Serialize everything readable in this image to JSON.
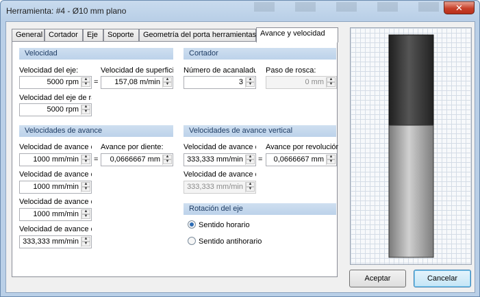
{
  "window": {
    "title": "Herramienta: #4 - Ø10 mm plano",
    "close_glyph": "✕"
  },
  "tabs": [
    {
      "label": "General"
    },
    {
      "label": "Cortador"
    },
    {
      "label": "Eje"
    },
    {
      "label": "Soporte"
    },
    {
      "label": "Geometría del porta herramientas"
    },
    {
      "label": "Avance y velocidad"
    }
  ],
  "active_tab": "Avance y velocidad",
  "velocidad": {
    "header": "Velocidad",
    "spindle_label": "Velocidad del eje:",
    "spindle_value": "5000 rpm",
    "surface_label": "Velocidad de superficie",
    "surface_value": "157,08 m/min",
    "ramp_label": "Velocidad del eje de ra",
    "ramp_value": "5000 rpm",
    "equals": "="
  },
  "cortador": {
    "header": "Cortador",
    "flutes_label": "Número de acanaladur",
    "flutes_value": "3",
    "pitch_label": "Paso de rosca:",
    "pitch_value": "0 mm"
  },
  "avance": {
    "header": "Velocidades de avance",
    "feed_label": "Velocidad de avance d",
    "feed_value": "1000 mm/min",
    "per_tooth_label": "Avance por diente:",
    "per_tooth_value": "0,0666667 mm",
    "entry_label": "Velocidad de avance d",
    "entry_value": "1000 mm/min",
    "exit_label": "Velocidad de avance d",
    "exit_value": "1000 mm/min",
    "ramp_label": "Velocidad de avance d",
    "ramp_value": "333,333 mm/min",
    "equals": "="
  },
  "avance_vertical": {
    "header": "Velocidades de avance vertical",
    "plunge_label": "Velocidad de avance d",
    "plunge_value": "333,333 mm/min",
    "per_rev_label": "Avance por revolución",
    "per_rev_value": "0,0666667 mm",
    "retract_label": "Velocidad de avance d",
    "retract_value": "333,333 mm/min",
    "equals": "="
  },
  "rotacion": {
    "header": "Rotación del eje",
    "options": [
      {
        "label": "Sentido horario",
        "selected": true
      },
      {
        "label": "Sentido antihorario",
        "selected": false
      }
    ]
  },
  "buttons": {
    "accept": "Aceptar",
    "cancel": "Cancelar"
  },
  "spin_glyphs": {
    "up": "▲",
    "down": "▼"
  },
  "colors": {
    "section_header_bg": "#c4d8ee",
    "tool_dark": "#3a3a3a",
    "tool_light": "#b5b5b5",
    "selected_radio": "#2d6cb5"
  }
}
